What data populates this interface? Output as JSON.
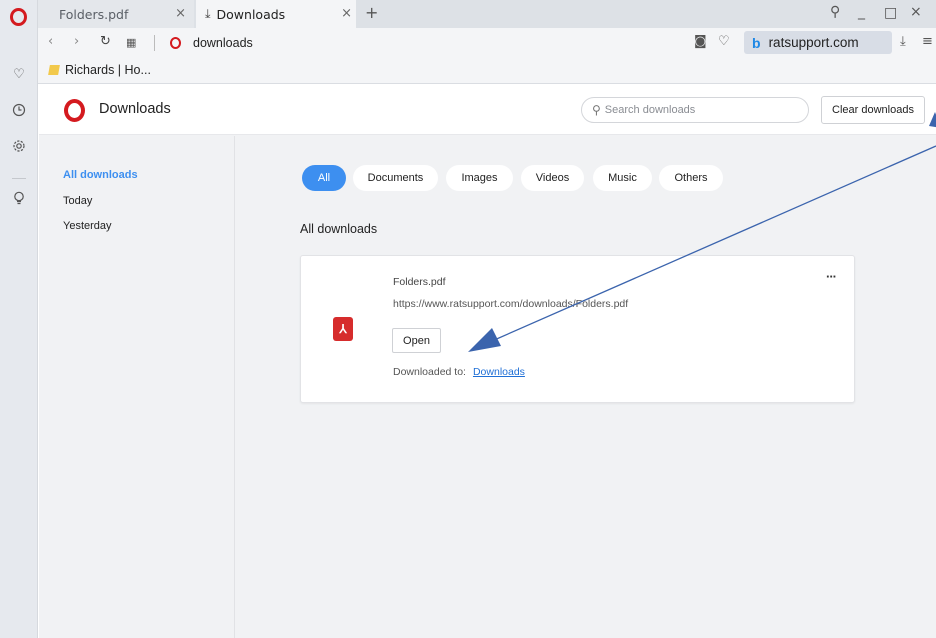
{
  "browser": {
    "tabs": [
      {
        "label": "Folders.pdf",
        "active": false
      },
      {
        "label": "Downloads",
        "active": true
      }
    ],
    "address": "downloads",
    "site_pill": "ratsupport.com",
    "bookmark": "Richards | Ho..."
  },
  "page": {
    "title": "Downloads",
    "search_placeholder": "Search downloads",
    "clear_label": "Clear downloads"
  },
  "sidebar": {
    "items": [
      {
        "label": "All downloads",
        "active": true
      },
      {
        "label": "Today",
        "active": false
      },
      {
        "label": "Yesterday",
        "active": false
      }
    ]
  },
  "filters": [
    "All",
    "Documents",
    "Images",
    "Videos",
    "Music",
    "Others"
  ],
  "section_title": "All downloads",
  "download": {
    "filename": "Folders.pdf",
    "url": "https://www.ratsupport.com/downloads/Folders.pdf",
    "open_label": "Open",
    "downloaded_to_label": "Downloaded to:",
    "location": "Downloads",
    "more": "···"
  },
  "colors": {
    "accent": "#3d8ff0",
    "opera_red": "#d41a1f",
    "annotation": "#3b64ad"
  },
  "icons": {
    "rail": [
      "opera-logo",
      "heart-icon",
      "history-icon",
      "settings-icon",
      "bulb-icon"
    ],
    "file": "pdf-icon"
  }
}
